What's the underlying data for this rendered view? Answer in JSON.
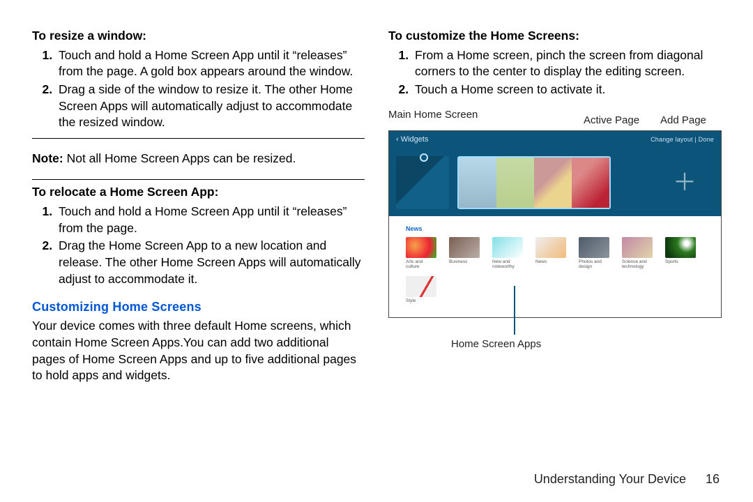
{
  "left": {
    "resize_head": "To resize a window:",
    "resize_steps": [
      "Touch and hold a Home Screen App until it “releases” from the page. A gold box appears around the window.",
      "Drag a side of the window to resize it. The other Home Screen Apps will automatically adjust to accommodate the resized window."
    ],
    "note_prefix": "Note:",
    "note_body": " Not all Home Screen Apps can be resized.",
    "relocate_head": "To relocate a Home Screen App:",
    "relocate_steps": [
      "Touch and hold a Home Screen App until it “releases” from the page.",
      "Drag the Home Screen App to a new location and release. The other Home Screen Apps will automatically adjust to accommodate it."
    ],
    "custom_head": "Customizing Home Screens",
    "custom_body": "Your device comes with three default Home screens, which contain Home Screen Apps.You can add two additional pages of Home Screen Apps and up to five additional pages to hold apps and widgets."
  },
  "right": {
    "customize_head": "To customize the Home Screens:",
    "customize_steps": [
      "From a Home screen, pinch the screen from diagonal corners to the center to display the editing screen.",
      "Touch a Home screen to activate it."
    ],
    "label_main": "Main Home Screen",
    "label_active": "Active Page",
    "label_add": "Add Page",
    "label_apps": "Home Screen Apps",
    "topbar_left": "‹  Widgets",
    "topbar_right": "Change layout  |  Done",
    "cats_title": "News",
    "cats_row1": [
      "Arts and culture",
      "Business",
      "New and noteworthy",
      "News",
      "Photos and design",
      "Science and technology",
      "Sports"
    ],
    "cats_row2": [
      "Style"
    ]
  },
  "footer": {
    "section": "Understanding Your Device",
    "page": "16"
  }
}
